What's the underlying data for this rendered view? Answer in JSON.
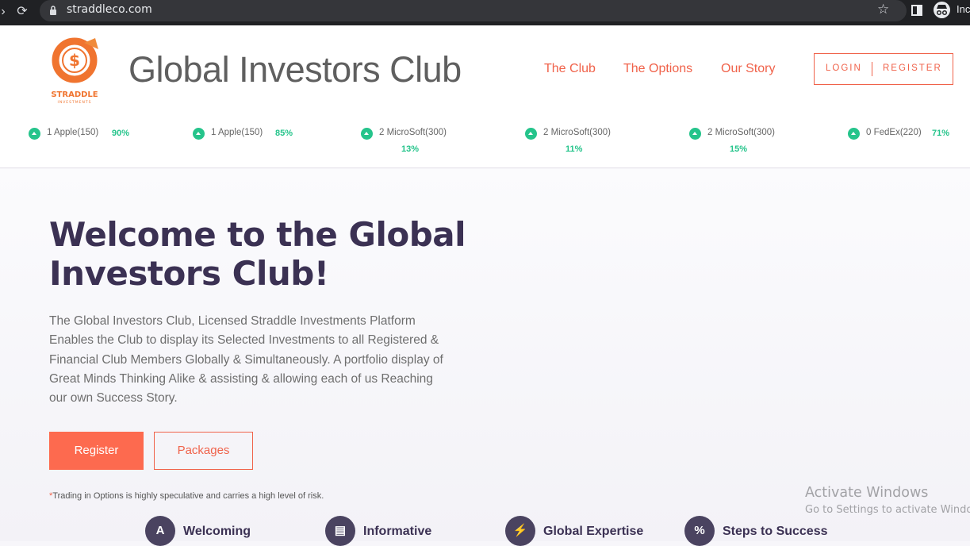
{
  "browser": {
    "url": "straddleco.com",
    "profile_label": "Inc"
  },
  "header": {
    "logo_text": "STRADDLE",
    "logo_subtext": "INVESTMENTS",
    "logo_symbol": "$",
    "brand": "Global Investors Club",
    "nav": [
      "The Club",
      "The Options",
      "Our Story"
    ],
    "login_label": "LOGIN",
    "register_label": "REGISTER"
  },
  "ticker": [
    {
      "label": "1 Apple(150)",
      "pct": "90%"
    },
    {
      "label": "1 Apple(150)",
      "pct": "85%"
    },
    {
      "label": "2 MicroSoft(300)",
      "pct": "13%"
    },
    {
      "label": "2 MicroSoft(300)",
      "pct": "11%"
    },
    {
      "label": "2 MicroSoft(300)",
      "pct": "15%"
    },
    {
      "label": "0 FedEx(220)",
      "pct": "71%"
    }
  ],
  "hero": {
    "title": "Welcome to the Global Investors Club!",
    "description": "The Global Investors Club, Licensed Straddle Investments Platform Enables the Club to display its Selected Investments to all Registered & Financial Club Members Globally & Simultaneously. A portfolio display of Great Minds Thinking Alike & assisting & allowing each of us Reaching our own Success Story.",
    "register_button": "Register",
    "packages_button": "Packages",
    "disclaimer_mark": "*",
    "disclaimer": "Trading in Options is highly speculative and carries a high level of risk."
  },
  "features": [
    {
      "label": "Welcoming",
      "icon": "compass-icon",
      "glyph": "A"
    },
    {
      "label": "Informative",
      "icon": "book-icon",
      "glyph": "▤"
    },
    {
      "label": "Global Expertise",
      "icon": "bolt-icon",
      "glyph": "⚡"
    },
    {
      "label": "Steps to Success",
      "icon": "percent-icon",
      "glyph": "%"
    }
  ],
  "watermark": {
    "title": "Activate Windows",
    "subtitle": "Go to Settings to activate Windows."
  },
  "colors": {
    "accent": "#f0624a",
    "button": "#fd6a4f",
    "heading": "#3b3153",
    "positive": "#25c48b"
  }
}
